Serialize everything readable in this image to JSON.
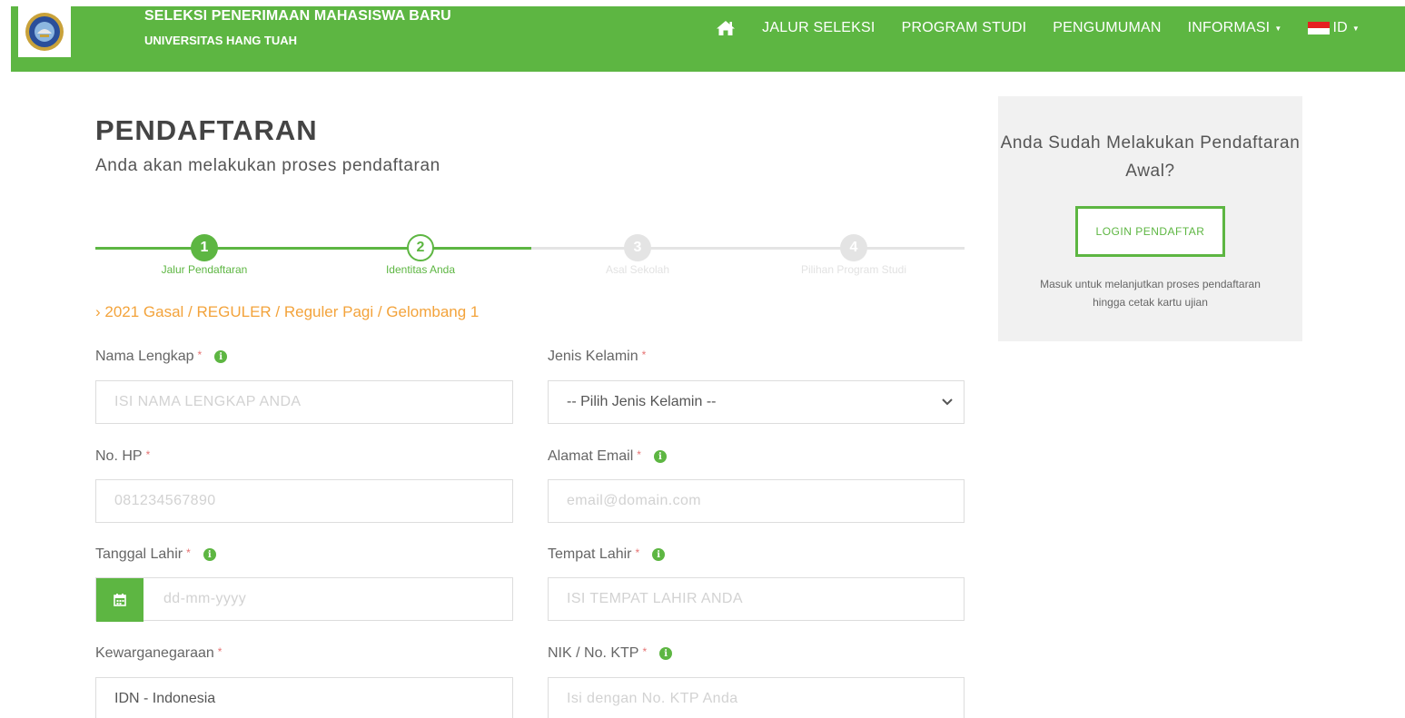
{
  "header": {
    "brand_title": "SELEKSI PENERIMAAN MAHASISWA BARU",
    "brand_subtitle": "UNIVERSITAS HANG TUAH",
    "nav": [
      {
        "label": "",
        "icon": "home-icon"
      },
      {
        "label": "JALUR SELEKSI"
      },
      {
        "label": "PROGRAM STUDI"
      },
      {
        "label": "PENGUMUMAN"
      },
      {
        "label": "INFORMASI",
        "dropdown": true
      },
      {
        "label": "ID",
        "icon": "flag-indonesia-icon",
        "dropdown": true
      }
    ],
    "accent_color": "#5db642"
  },
  "main": {
    "title": "PENDAFTARAN",
    "subtitle": "Anda akan melakukan proses pendaftaran",
    "steps": [
      {
        "number": "1",
        "label": "Jalur Pendaftaran",
        "state": "done"
      },
      {
        "number": "2",
        "label": "Identitas Anda",
        "state": "current"
      },
      {
        "number": "3",
        "label": "Asal Sekolah",
        "state": "pending"
      },
      {
        "number": "4",
        "label": "Pilihan Program Studi",
        "state": "pending"
      }
    ],
    "breadcrumb": "› 2021 Gasal / REGULER / Reguler Pagi / Gelombang 1"
  },
  "form": {
    "nama_lengkap": {
      "label": "Nama Lengkap",
      "placeholder": "ISI NAMA LENGKAP ANDA"
    },
    "jenis_kelamin": {
      "label": "Jenis Kelamin",
      "value": "-- Pilih Jenis Kelamin --"
    },
    "no_hp": {
      "label": "No. HP",
      "placeholder": "081234567890"
    },
    "email": {
      "label": "Alamat Email",
      "placeholder": "email@domain.com"
    },
    "tanggal_lahir": {
      "label": "Tanggal Lahir",
      "placeholder": "dd-mm-yyyy"
    },
    "tempat_lahir": {
      "label": "Tempat Lahir",
      "placeholder": "ISI TEMPAT LAHIR ANDA"
    },
    "kewarganegaraan": {
      "label": "Kewarganegaraan",
      "value": "IDN - Indonesia"
    },
    "nik": {
      "label": "NIK / No. KTP",
      "placeholder": "Isi dengan No. KTP Anda"
    },
    "required_mark": "*"
  },
  "side_panel": {
    "title": "Anda Sudah Melakukan Pendaftaran Awal?",
    "button": "LOGIN PENDAFTAR",
    "description": "Masuk untuk melanjutkan proses pendaftaran hingga cetak kartu ujian"
  }
}
